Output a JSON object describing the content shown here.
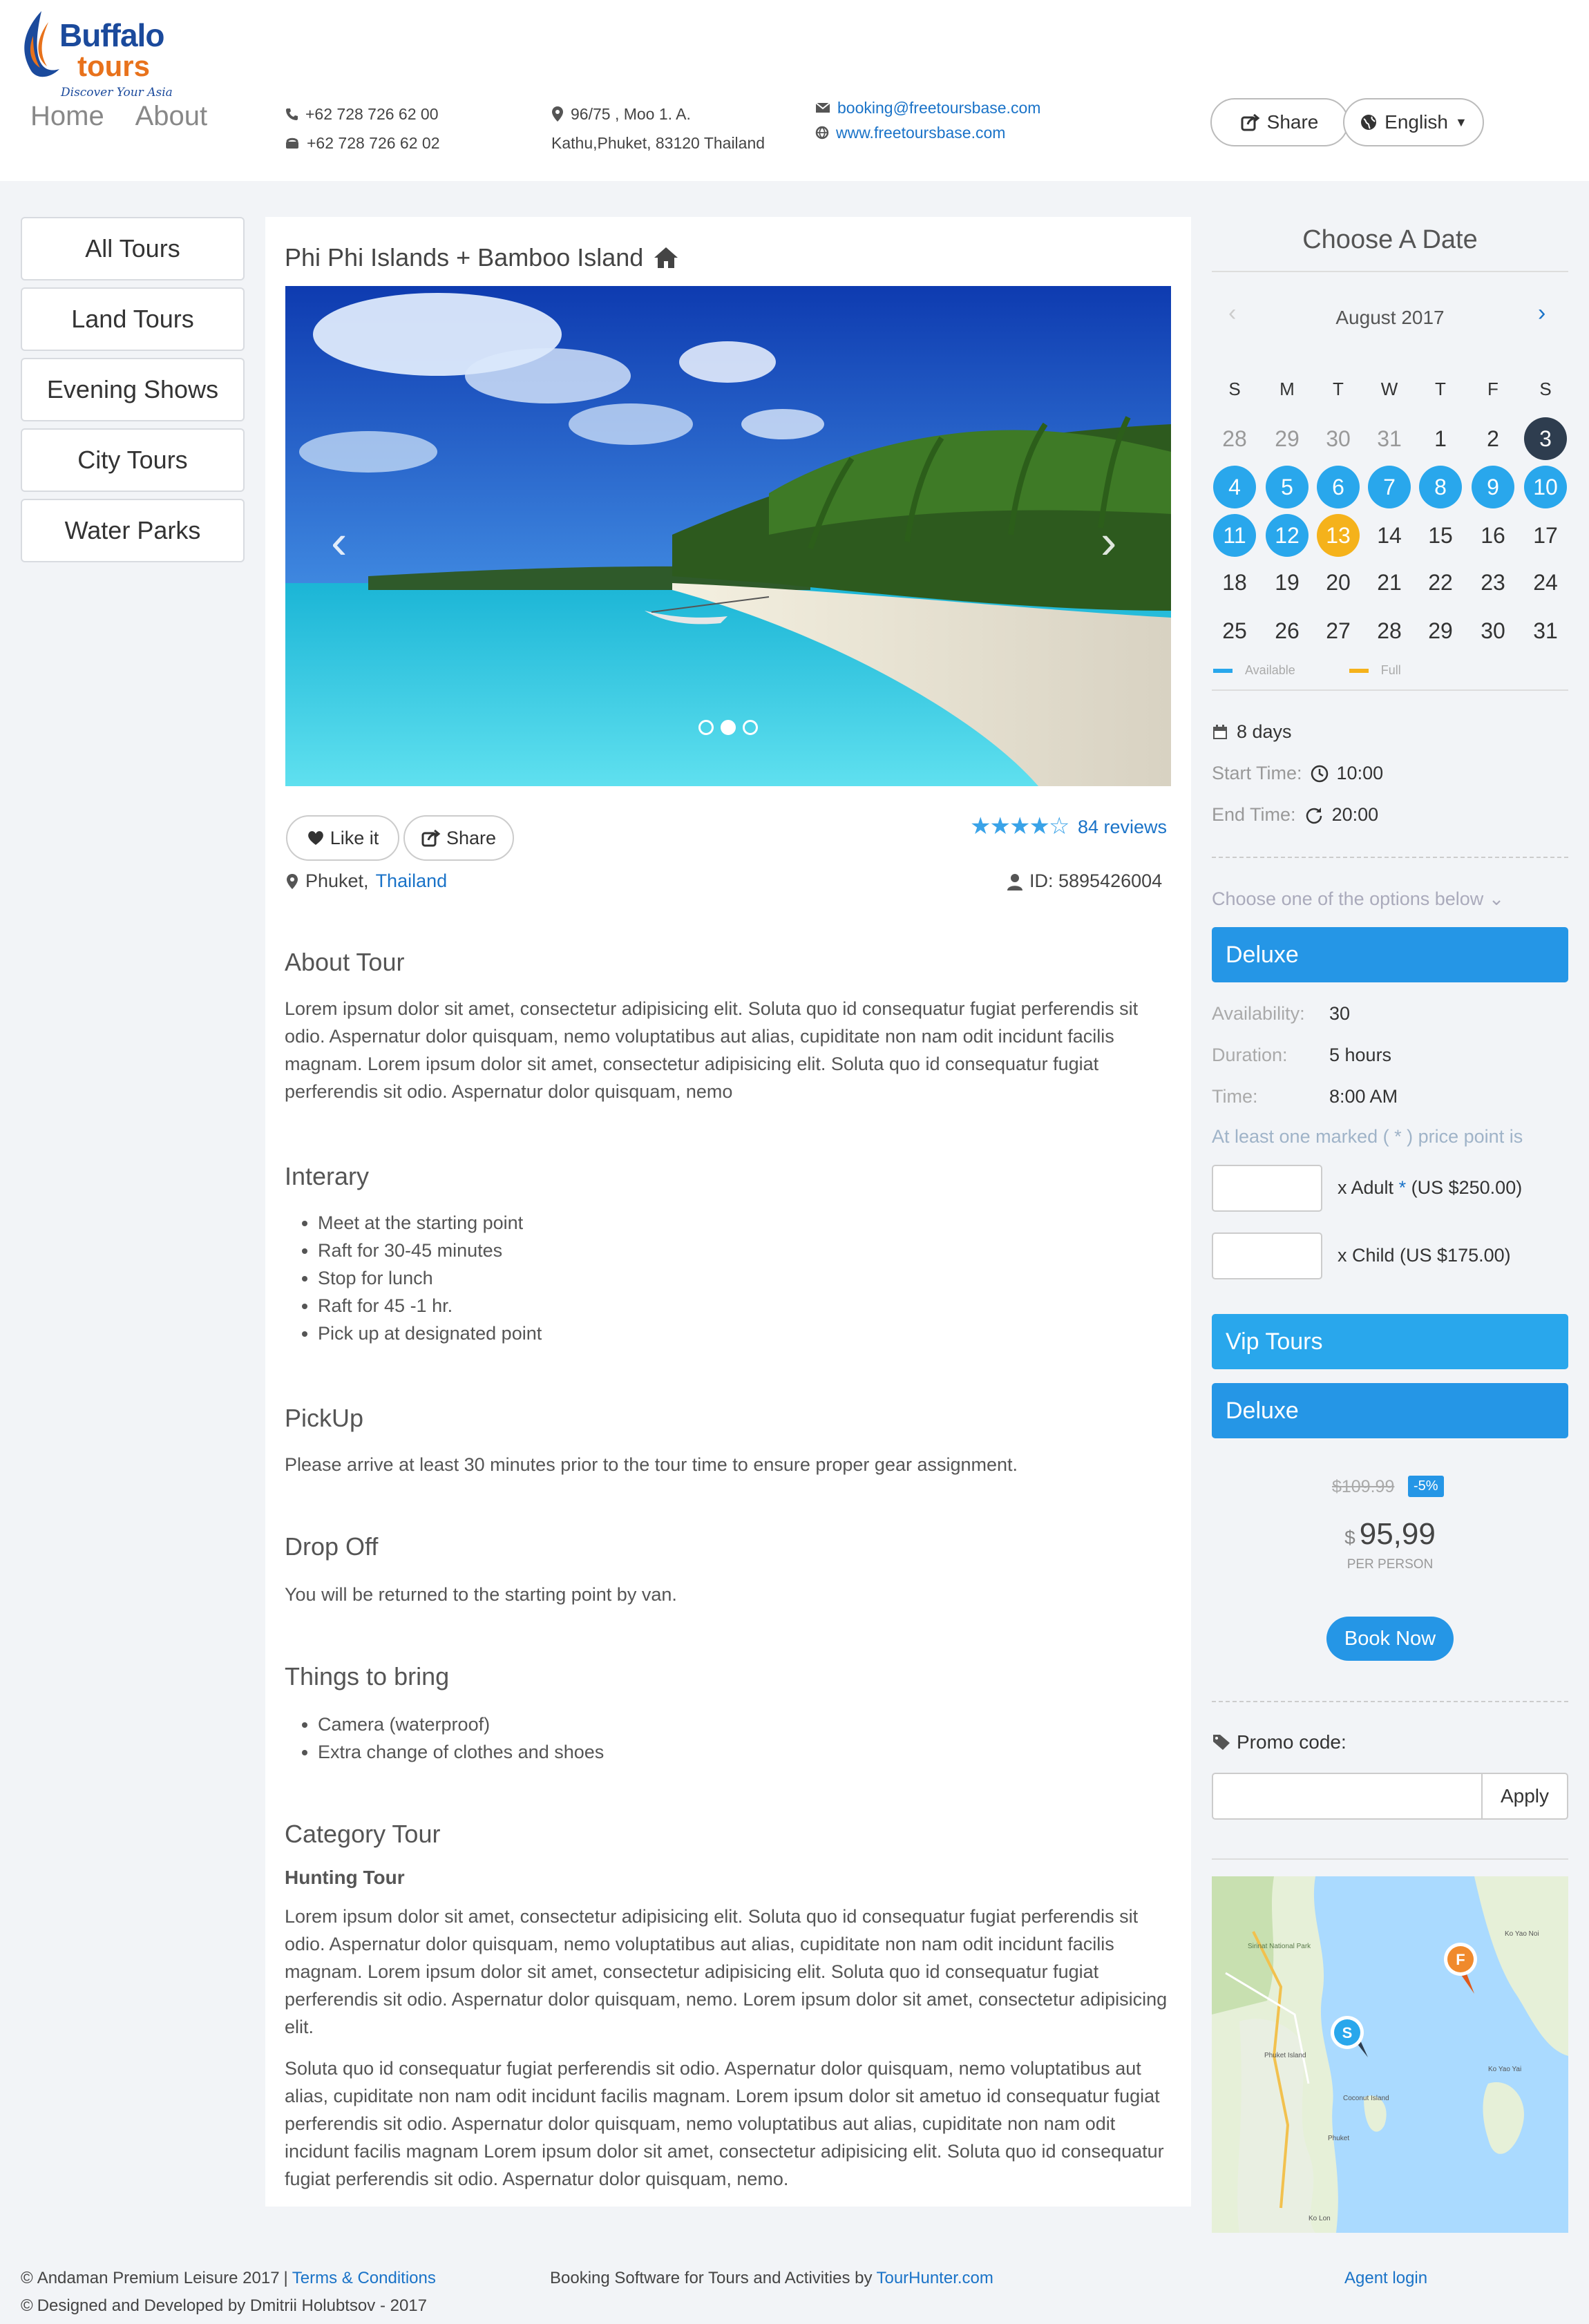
{
  "brand": {
    "name": "Buffalo",
    "name2": "tours",
    "slogan": "Discover Your Asia"
  },
  "nav": [
    "Home",
    "About"
  ],
  "contact": {
    "phone1": "+62 728 726 62 00",
    "phone2": "+62 728 726 62 02",
    "address1": "96/75 , Moo 1. A.",
    "address2": "Kathu,Phuket, 83120 Thailand",
    "email": "booking@freetoursbase.com",
    "website": "www.freetoursbase.com"
  },
  "header_actions": {
    "share": "Share",
    "language": "English"
  },
  "categories": [
    "All Tours",
    "Land Tours",
    "Evening Shows",
    "City Tours",
    "Water Parks"
  ],
  "tour": {
    "title": "Phi Phi Islands + Bamboo Island",
    "like": "Like it",
    "share": "Share",
    "rating": 4,
    "reviews": "84 reviews",
    "location_city": "Phuket,",
    "location_country": "Thailand",
    "id": "ID: 5895426004"
  },
  "sections": {
    "about_title": "About Tour",
    "about_text": "Lorem ipsum dolor sit amet, consectetur adipisicing elit. Soluta quo id consequatur fugiat perferendis sit odio. Aspernatur dolor quisquam, nemo voluptatibus aut alias, cupiditate non nam odit incidunt facilis magnam. Lorem ipsum dolor sit amet, consectetur adipisicing elit. Soluta quo id consequatur fugiat perferendis sit odio. Aspernatur dolor quisquam, nemo",
    "itinerary_title": "Interary",
    "itinerary": [
      "Meet at the starting point",
      "Raft for 30-45 minutes",
      "Stop for lunch",
      "Raft for 45 -1 hr.",
      "Pick up at designated point"
    ],
    "pickup_title": "PickUp",
    "pickup_text": "Please arrive at least 30 minutes prior to the tour time to ensure proper gear assignment.",
    "dropoff_title": "Drop Off",
    "dropoff_text": "You will be returned to the starting point by van.",
    "bring_title": "Things to bring",
    "bring": [
      "Camera (waterproof)",
      "Extra change of clothes and shoes"
    ],
    "category_title": "Category Tour",
    "category_sub": "Hunting Tour",
    "category_text1": "Lorem ipsum dolor sit amet, consectetur adipisicing elit. Soluta quo id consequatur fugiat perferendis sit odio. Aspernatur dolor quisquam, nemo voluptatibus aut alias, cupiditate non nam odit incidunt facilis magnam. Lorem ipsum dolor sit amet, consectetur adipisicing elit. Soluta quo id consequatur fugiat perferendis sit odio. Aspernatur dolor quisquam, nemo. Lorem ipsum dolor sit amet, consectetur adipisicing elit.",
    "category_text2": "Soluta quo id consequatur fugiat perferendis sit odio. Aspernatur dolor quisquam, nemo voluptatibus aut alias, cupiditate non nam odit incidunt facilis magnam. Lorem ipsum dolor sit ametuo id consequatur fugiat perferendis sit odio. Aspernatur dolor quisquam, nemo voluptatibus aut alias, cupiditate non nam odit incidunt facilis magnam Lorem ipsum dolor sit amet, consectetur adipisicing elit. Soluta quo id consequatur fugiat perferendis sit odio. Aspernatur dolor quisquam, nemo."
  },
  "calendar": {
    "title": "Choose A Date",
    "month": "August 2017",
    "weekdays": [
      "S",
      "M",
      "T",
      "W",
      "T",
      "F",
      "S"
    ],
    "weeks": [
      [
        "28",
        "29",
        "30",
        "31",
        "1",
        "2",
        "3"
      ],
      [
        "4",
        "5",
        "6",
        "7",
        "8",
        "9",
        "10"
      ],
      [
        "11",
        "12",
        "13",
        "14",
        "15",
        "16",
        "17"
      ],
      [
        "18",
        "19",
        "20",
        "21",
        "22",
        "23",
        "24"
      ],
      [
        "25",
        "26",
        "27",
        "28",
        "29",
        "30",
        "31"
      ]
    ],
    "legend_available": "Available",
    "legend_full": "Full",
    "colors": {
      "available": "#29a7ec",
      "full": "#f5b21b",
      "selected": "#2e3d4f"
    }
  },
  "booking": {
    "duration_days": "8 days",
    "start_label": "Start Time:",
    "start_time": "10:00",
    "end_label": "End Time:",
    "end_time": "20:00",
    "options_prompt": "Choose one of the options below",
    "option1": "Deluxe",
    "availability_label": "Availability:",
    "availability": "30",
    "duration_label": "Duration:",
    "duration": "5 hours",
    "time_label": "Time:",
    "time": "8:00 AM",
    "marked_note": "At least one marked ( * ) price point is",
    "adult_label": "x Adult",
    "adult_star": "*",
    "adult_price": "(US $250.00)",
    "child_label": "x Child (US $175.00)",
    "option2": "Vip Tours",
    "option3": "Deluxe",
    "old_price": "$109.99",
    "discount": "-5%",
    "currency": "$",
    "price": "95,99",
    "per_person": "PER PERSON",
    "book_now": "Book Now",
    "promo_label": "Promo code:",
    "apply": "Apply"
  },
  "map": {
    "labels": [
      "Sirinat National Park",
      "Phuket Island",
      "Coconut Island",
      "Phuket",
      "Ko Yao Noi",
      "Ko Yao Yai",
      "Ko Lon"
    ],
    "pins": [
      "S",
      "F"
    ]
  },
  "footer": {
    "copyright": "Andaman Premium Leisure 2017",
    "terms": "Terms & Conditions",
    "designed": "Designed and Developed by Dmitrii Holubtsov - 2017",
    "software_text": "Booking Software for Tours and Activities by",
    "software_link": "TourHunter.com",
    "agent_login": "Agent login"
  }
}
